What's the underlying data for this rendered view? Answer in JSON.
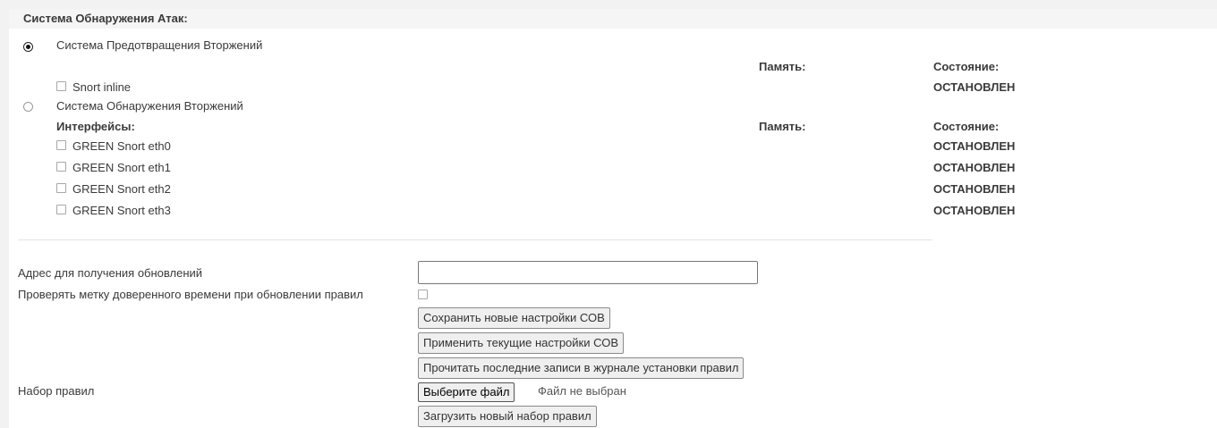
{
  "ids": {
    "title": "Система Обнаружения Атак:",
    "ips": {
      "label": "Система Предотвращения Вторжений",
      "selected": true,
      "memory_label": "Память:",
      "state_label": "Состояние:",
      "items": [
        {
          "label": "Snort inline",
          "checked": false,
          "state": "ОСТАНОВЛЕН"
        }
      ]
    },
    "idsmode": {
      "label": "Система Обнаружения Вторжений",
      "selected": false,
      "interfaces_label": "Интерфейсы:",
      "memory_label": "Память:",
      "state_label": "Состояние:",
      "items": [
        {
          "label": "GREEN Snort eth0",
          "checked": false,
          "state": "ОСТАНОВЛЕН"
        },
        {
          "label": "GREEN Snort eth1",
          "checked": false,
          "state": "ОСТАНОВЛЕН"
        },
        {
          "label": "GREEN Snort eth2",
          "checked": false,
          "state": "ОСТАНОВЛЕН"
        },
        {
          "label": "GREEN Snort eth3",
          "checked": false,
          "state": "ОСТАНОВЛЕН"
        }
      ]
    }
  },
  "settings": {
    "update_url_label": "Адрес для получения обновлений",
    "update_url_value": "",
    "verify_timestamp_label": "Проверять метку доверенного времени при обновлении правил",
    "verify_timestamp_checked": false,
    "save_button": "Сохранить новые настройки СОВ",
    "apply_button": "Применить текущие настройки СОВ",
    "read_log_button": "Прочитать последние записи в журнале установки правил",
    "ruleset_label": "Набор правил",
    "choose_file_button": "Выберите файл",
    "no_file_text": "Файл не выбран",
    "upload_button": "Загрузить новый набор правил"
  }
}
